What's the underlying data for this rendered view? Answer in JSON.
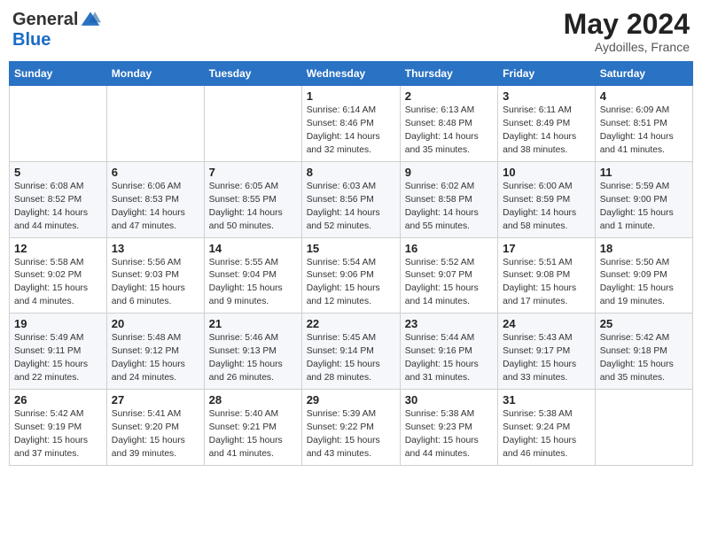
{
  "header": {
    "logo_general": "General",
    "logo_blue": "Blue",
    "month_year": "May 2024",
    "location": "Aydoilles, France"
  },
  "days_of_week": [
    "Sunday",
    "Monday",
    "Tuesday",
    "Wednesday",
    "Thursday",
    "Friday",
    "Saturday"
  ],
  "weeks": [
    [
      {
        "day": "",
        "sunrise": "",
        "sunset": "",
        "daylight": ""
      },
      {
        "day": "",
        "sunrise": "",
        "sunset": "",
        "daylight": ""
      },
      {
        "day": "",
        "sunrise": "",
        "sunset": "",
        "daylight": ""
      },
      {
        "day": "1",
        "sunrise": "Sunrise: 6:14 AM",
        "sunset": "Sunset: 8:46 PM",
        "daylight": "Daylight: 14 hours and 32 minutes."
      },
      {
        "day": "2",
        "sunrise": "Sunrise: 6:13 AM",
        "sunset": "Sunset: 8:48 PM",
        "daylight": "Daylight: 14 hours and 35 minutes."
      },
      {
        "day": "3",
        "sunrise": "Sunrise: 6:11 AM",
        "sunset": "Sunset: 8:49 PM",
        "daylight": "Daylight: 14 hours and 38 minutes."
      },
      {
        "day": "4",
        "sunrise": "Sunrise: 6:09 AM",
        "sunset": "Sunset: 8:51 PM",
        "daylight": "Daylight: 14 hours and 41 minutes."
      }
    ],
    [
      {
        "day": "5",
        "sunrise": "Sunrise: 6:08 AM",
        "sunset": "Sunset: 8:52 PM",
        "daylight": "Daylight: 14 hours and 44 minutes."
      },
      {
        "day": "6",
        "sunrise": "Sunrise: 6:06 AM",
        "sunset": "Sunset: 8:53 PM",
        "daylight": "Daylight: 14 hours and 47 minutes."
      },
      {
        "day": "7",
        "sunrise": "Sunrise: 6:05 AM",
        "sunset": "Sunset: 8:55 PM",
        "daylight": "Daylight: 14 hours and 50 minutes."
      },
      {
        "day": "8",
        "sunrise": "Sunrise: 6:03 AM",
        "sunset": "Sunset: 8:56 PM",
        "daylight": "Daylight: 14 hours and 52 minutes."
      },
      {
        "day": "9",
        "sunrise": "Sunrise: 6:02 AM",
        "sunset": "Sunset: 8:58 PM",
        "daylight": "Daylight: 14 hours and 55 minutes."
      },
      {
        "day": "10",
        "sunrise": "Sunrise: 6:00 AM",
        "sunset": "Sunset: 8:59 PM",
        "daylight": "Daylight: 14 hours and 58 minutes."
      },
      {
        "day": "11",
        "sunrise": "Sunrise: 5:59 AM",
        "sunset": "Sunset: 9:00 PM",
        "daylight": "Daylight: 15 hours and 1 minute."
      }
    ],
    [
      {
        "day": "12",
        "sunrise": "Sunrise: 5:58 AM",
        "sunset": "Sunset: 9:02 PM",
        "daylight": "Daylight: 15 hours and 4 minutes."
      },
      {
        "day": "13",
        "sunrise": "Sunrise: 5:56 AM",
        "sunset": "Sunset: 9:03 PM",
        "daylight": "Daylight: 15 hours and 6 minutes."
      },
      {
        "day": "14",
        "sunrise": "Sunrise: 5:55 AM",
        "sunset": "Sunset: 9:04 PM",
        "daylight": "Daylight: 15 hours and 9 minutes."
      },
      {
        "day": "15",
        "sunrise": "Sunrise: 5:54 AM",
        "sunset": "Sunset: 9:06 PM",
        "daylight": "Daylight: 15 hours and 12 minutes."
      },
      {
        "day": "16",
        "sunrise": "Sunrise: 5:52 AM",
        "sunset": "Sunset: 9:07 PM",
        "daylight": "Daylight: 15 hours and 14 minutes."
      },
      {
        "day": "17",
        "sunrise": "Sunrise: 5:51 AM",
        "sunset": "Sunset: 9:08 PM",
        "daylight": "Daylight: 15 hours and 17 minutes."
      },
      {
        "day": "18",
        "sunrise": "Sunrise: 5:50 AM",
        "sunset": "Sunset: 9:09 PM",
        "daylight": "Daylight: 15 hours and 19 minutes."
      }
    ],
    [
      {
        "day": "19",
        "sunrise": "Sunrise: 5:49 AM",
        "sunset": "Sunset: 9:11 PM",
        "daylight": "Daylight: 15 hours and 22 minutes."
      },
      {
        "day": "20",
        "sunrise": "Sunrise: 5:48 AM",
        "sunset": "Sunset: 9:12 PM",
        "daylight": "Daylight: 15 hours and 24 minutes."
      },
      {
        "day": "21",
        "sunrise": "Sunrise: 5:46 AM",
        "sunset": "Sunset: 9:13 PM",
        "daylight": "Daylight: 15 hours and 26 minutes."
      },
      {
        "day": "22",
        "sunrise": "Sunrise: 5:45 AM",
        "sunset": "Sunset: 9:14 PM",
        "daylight": "Daylight: 15 hours and 28 minutes."
      },
      {
        "day": "23",
        "sunrise": "Sunrise: 5:44 AM",
        "sunset": "Sunset: 9:16 PM",
        "daylight": "Daylight: 15 hours and 31 minutes."
      },
      {
        "day": "24",
        "sunrise": "Sunrise: 5:43 AM",
        "sunset": "Sunset: 9:17 PM",
        "daylight": "Daylight: 15 hours and 33 minutes."
      },
      {
        "day": "25",
        "sunrise": "Sunrise: 5:42 AM",
        "sunset": "Sunset: 9:18 PM",
        "daylight": "Daylight: 15 hours and 35 minutes."
      }
    ],
    [
      {
        "day": "26",
        "sunrise": "Sunrise: 5:42 AM",
        "sunset": "Sunset: 9:19 PM",
        "daylight": "Daylight: 15 hours and 37 minutes."
      },
      {
        "day": "27",
        "sunrise": "Sunrise: 5:41 AM",
        "sunset": "Sunset: 9:20 PM",
        "daylight": "Daylight: 15 hours and 39 minutes."
      },
      {
        "day": "28",
        "sunrise": "Sunrise: 5:40 AM",
        "sunset": "Sunset: 9:21 PM",
        "daylight": "Daylight: 15 hours and 41 minutes."
      },
      {
        "day": "29",
        "sunrise": "Sunrise: 5:39 AM",
        "sunset": "Sunset: 9:22 PM",
        "daylight": "Daylight: 15 hours and 43 minutes."
      },
      {
        "day": "30",
        "sunrise": "Sunrise: 5:38 AM",
        "sunset": "Sunset: 9:23 PM",
        "daylight": "Daylight: 15 hours and 44 minutes."
      },
      {
        "day": "31",
        "sunrise": "Sunrise: 5:38 AM",
        "sunset": "Sunset: 9:24 PM",
        "daylight": "Daylight: 15 hours and 46 minutes."
      },
      {
        "day": "",
        "sunrise": "",
        "sunset": "",
        "daylight": ""
      }
    ]
  ]
}
